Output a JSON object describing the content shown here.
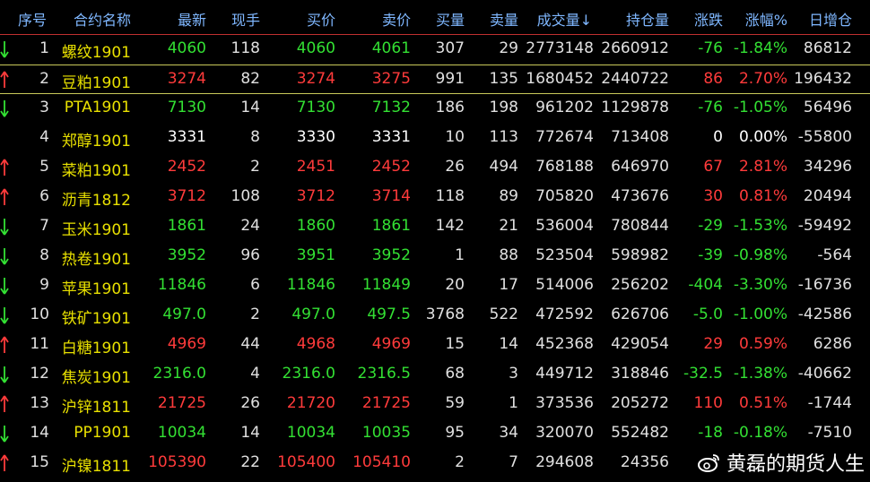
{
  "headers": [
    "序号",
    "合约名称",
    "最新",
    "现手",
    "买价",
    "卖价",
    "买量",
    "卖量",
    "成交量↓",
    "持仓量",
    "涨跌",
    "涨幅%",
    "日增仓"
  ],
  "colors": {
    "up": "#ff3b3b",
    "down": "#33e033",
    "flat": "#ffffff",
    "name": "#e8e000",
    "num": "#e0e0e0",
    "header": "#7fb7ff"
  },
  "rows": [
    {
      "no": "1",
      "dir": "down",
      "name": "螺纹1901",
      "last": "4060",
      "vol_hand": "118",
      "bid": "4060",
      "ask": "4061",
      "bid_qty": "307",
      "ask_qty": "29",
      "volume": "2773148",
      "oi": "2660912",
      "chg": "-76",
      "pct": "-1.84%",
      "oi_chg": "86812"
    },
    {
      "no": "2",
      "dir": "up",
      "name": "豆粕1901",
      "last": "3274",
      "vol_hand": "82",
      "bid": "3274",
      "ask": "3275",
      "bid_qty": "991",
      "ask_qty": "135",
      "volume": "1680452",
      "oi": "2440722",
      "chg": "86",
      "pct": "2.70%",
      "oi_chg": "196432"
    },
    {
      "no": "3",
      "dir": "down",
      "name": "PTA1901",
      "last": "7130",
      "vol_hand": "14",
      "bid": "7130",
      "ask": "7132",
      "bid_qty": "186",
      "ask_qty": "198",
      "volume": "961202",
      "oi": "1129878",
      "chg": "-76",
      "pct": "-1.05%",
      "oi_chg": "56496"
    },
    {
      "no": "4",
      "dir": "flat",
      "name": "郑醇1901",
      "last": "3331",
      "vol_hand": "8",
      "bid": "3330",
      "ask": "3331",
      "bid_qty": "10",
      "ask_qty": "113",
      "volume": "772674",
      "oi": "713408",
      "chg": "0",
      "pct": "0.00%",
      "oi_chg": "-55800"
    },
    {
      "no": "5",
      "dir": "up",
      "name": "菜粕1901",
      "last": "2452",
      "vol_hand": "2",
      "bid": "2451",
      "ask": "2452",
      "bid_qty": "26",
      "ask_qty": "494",
      "volume": "768188",
      "oi": "646970",
      "chg": "67",
      "pct": "2.81%",
      "oi_chg": "34296"
    },
    {
      "no": "6",
      "dir": "up",
      "name": "沥青1812",
      "last": "3712",
      "vol_hand": "108",
      "bid": "3712",
      "ask": "3714",
      "bid_qty": "118",
      "ask_qty": "89",
      "volume": "705820",
      "oi": "473676",
      "chg": "30",
      "pct": "0.81%",
      "oi_chg": "20494"
    },
    {
      "no": "7",
      "dir": "down",
      "name": "玉米1901",
      "last": "1861",
      "vol_hand": "24",
      "bid": "1860",
      "ask": "1861",
      "bid_qty": "142",
      "ask_qty": "21",
      "volume": "536004",
      "oi": "780844",
      "chg": "-29",
      "pct": "-1.53%",
      "oi_chg": "-59492"
    },
    {
      "no": "8",
      "dir": "down",
      "name": "热卷1901",
      "last": "3952",
      "vol_hand": "96",
      "bid": "3951",
      "ask": "3952",
      "bid_qty": "1",
      "ask_qty": "88",
      "volume": "523504",
      "oi": "598982",
      "chg": "-39",
      "pct": "-0.98%",
      "oi_chg": "-564"
    },
    {
      "no": "9",
      "dir": "down",
      "name": "苹果1901",
      "last": "11846",
      "vol_hand": "6",
      "bid": "11846",
      "ask": "11849",
      "bid_qty": "20",
      "ask_qty": "17",
      "volume": "514006",
      "oi": "256202",
      "chg": "-404",
      "pct": "-3.30%",
      "oi_chg": "-16736"
    },
    {
      "no": "10",
      "dir": "down",
      "name": "铁矿1901",
      "last": "497.0",
      "vol_hand": "2",
      "bid": "497.0",
      "ask": "497.5",
      "bid_qty": "3768",
      "ask_qty": "522",
      "volume": "472592",
      "oi": "626706",
      "chg": "-5.0",
      "pct": "-1.00%",
      "oi_chg": "-42586"
    },
    {
      "no": "11",
      "dir": "up",
      "name": "白糖1901",
      "last": "4969",
      "vol_hand": "44",
      "bid": "4968",
      "ask": "4969",
      "bid_qty": "15",
      "ask_qty": "14",
      "volume": "452368",
      "oi": "429054",
      "chg": "29",
      "pct": "0.59%",
      "oi_chg": "6286"
    },
    {
      "no": "12",
      "dir": "down",
      "name": "焦炭1901",
      "last": "2316.0",
      "vol_hand": "4",
      "bid": "2316.0",
      "ask": "2316.5",
      "bid_qty": "68",
      "ask_qty": "3",
      "volume": "449712",
      "oi": "318846",
      "chg": "-32.5",
      "pct": "-1.38%",
      "oi_chg": "-40662"
    },
    {
      "no": "13",
      "dir": "up",
      "name": "沪锌1811",
      "last": "21725",
      "vol_hand": "26",
      "bid": "21720",
      "ask": "21725",
      "bid_qty": "59",
      "ask_qty": "1",
      "volume": "373536",
      "oi": "205272",
      "chg": "110",
      "pct": "0.51%",
      "oi_chg": "-1744"
    },
    {
      "no": "14",
      "dir": "down",
      "name": "PP1901",
      "last": "10034",
      "vol_hand": "14",
      "bid": "10034",
      "ask": "10035",
      "bid_qty": "95",
      "ask_qty": "34",
      "volume": "320070",
      "oi": "552482",
      "chg": "-18",
      "pct": "-0.18%",
      "oi_chg": "-7510"
    },
    {
      "no": "15",
      "dir": "up",
      "name": "沪镍1811",
      "last": "105390",
      "vol_hand": "22",
      "bid": "105400",
      "ask": "105410",
      "bid_qty": "2",
      "ask_qty": "7",
      "volume": "294608",
      "oi": "24356",
      "chg": "",
      "pct": "",
      "oi_chg": ""
    }
  ],
  "watermark": "黄磊的期货人生",
  "watermark_icon": "weibo-icon"
}
